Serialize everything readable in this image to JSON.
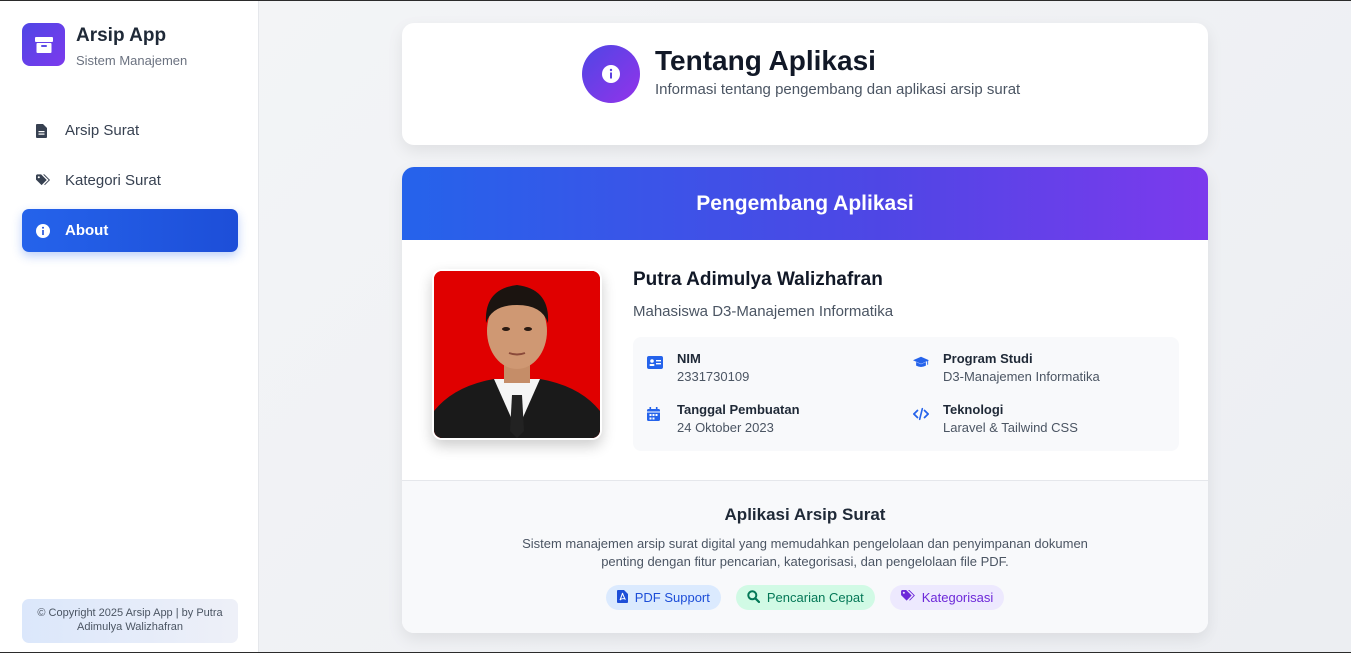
{
  "brand": {
    "title": "Arsip App",
    "subtitle": "Sistem Manajemen",
    "icon": "archive-icon"
  },
  "sidebar": {
    "items": [
      {
        "label": "Arsip Surat",
        "icon": "file-icon",
        "active": false
      },
      {
        "label": "Kategori Surat",
        "icon": "tags-icon",
        "active": false
      },
      {
        "label": "About",
        "icon": "info-icon",
        "active": true
      }
    ],
    "copyright": "© Copyright 2025 Arsip App | by Putra Adimulya Walizhafran"
  },
  "header": {
    "title": "Tentang Aplikasi",
    "subtitle": "Informasi tentang pengembang dan aplikasi arsip surat",
    "icon": "info-icon"
  },
  "developer": {
    "banner": "Pengembang Aplikasi",
    "name": "Putra Adimulya Walizhafran",
    "role": "Mahasiswa D3-Manajemen Informatika",
    "info": {
      "nim_label": "NIM",
      "nim_value": "2331730109",
      "prodi_label": "Program Studi",
      "prodi_value": "D3-Manajemen Informatika",
      "date_label": "Tanggal Pembuatan",
      "date_value": "24 Oktober 2023",
      "tech_label": "Teknologi",
      "tech_value": "Laravel & Tailwind CSS"
    }
  },
  "app": {
    "title": "Aplikasi Arsip Surat",
    "description": "Sistem manajemen arsip surat digital yang memudahkan pengelolaan dan penyimpanan dokumen penting dengan fitur pencarian, kategorisasi, dan pengelolaan file PDF.",
    "tags": [
      {
        "label": "PDF Support",
        "icon": "file-pdf-icon",
        "color": "#1d4ed8"
      },
      {
        "label": "Pencarian Cepat",
        "icon": "search-icon",
        "color": "#047857"
      },
      {
        "label": "Kategorisasi",
        "icon": "tags-icon",
        "color": "#6d28d9"
      }
    ]
  },
  "colors": {
    "accent": "#2563eb",
    "gradient_purple": "#7c3aed",
    "photo_bg": "#e00000"
  }
}
